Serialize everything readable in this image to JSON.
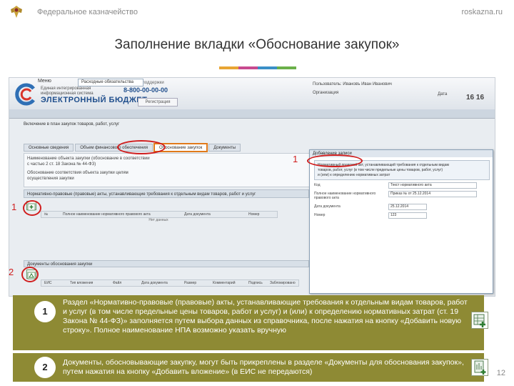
{
  "header": {
    "org_name": "Федеральное казначейство",
    "site": "roskazna.ru",
    "title": "Заполнение вкладки «Обоснование закупок»",
    "accent_colors": [
      "#e8a534",
      "#c84a8f",
      "#3a8fc7",
      "#6bb04a"
    ]
  },
  "app": {
    "logo_small_text": "Единая интегрированная информационная система",
    "logo_name": "ЭЛЕКТРОННЫЙ БЮДЖЕТ",
    "phone_label": "Телефон поддержки",
    "phone": "8-800-00-00-00",
    "support_button": "Регистрация",
    "user_line1": "Пользователь: Ивановъ Иван Иванович",
    "user_line2": "Организация",
    "date_label": "Дата",
    "time": "16 16",
    "nav_menu": "Меню",
    "nav_tab": "Расходные обязательства"
  },
  "document": {
    "title": "Включение в план закупок товаров, работ, услуг",
    "tabs": [
      "Основные сведения",
      "Объем финансового обеспечения",
      "Обоснование закупок",
      "Документы"
    ],
    "active_tab": 2,
    "left_lines": [
      "Наименование объекта закупки (обоснование в соответствии",
      "с частью 2 ст. 18 Закона № 44-ФЗ)",
      "Обоснование соответствия объекта закупки целям",
      "осуществления закупки"
    ],
    "npa_header": "Нормативно-правовые (правовые) акты, устанавливающие требования к отдельным видам товаров, работ и услуг",
    "npa_columns": [
      "№",
      "Полное наименование нормативного правового акта",
      "Дата документа",
      "Номер"
    ],
    "npa_empty": "Нет данных",
    "docs_header": "Документы обоснования закупки",
    "docs_columns": [
      "ЕИС",
      "Тип вложения",
      "Файл",
      "Дата документа",
      "Размер",
      "Комментарий",
      "Подпись",
      "Заблокировано"
    ]
  },
  "dialog": {
    "title": "Добавление записи",
    "rows": [
      "Нормативный правовой акт, устанавливающий требования к отдельным видам",
      "товаров, работ, услуг (в том числе предельные цены товаров, работ, услуг)",
      "и (или) к определению нормативных затрат"
    ],
    "field1_label": "Код",
    "field1_value": "Текст нормативного акта",
    "field2_label": "Полное наименование нормативного правового акта",
    "field2_value": "Приказ № от 25.12.2014",
    "field3_label": "Дата документа",
    "field3_value": "25.12.2014",
    "field4_label": "Номер",
    "field4_value": "123"
  },
  "callouts": {
    "n1": "1",
    "n2": "2"
  },
  "blocks": [
    {
      "number": "1",
      "text": "Раздел «Нормативно-правовые (правовые) акты, устанавливающие требования к отдельным видам товаров, работ и услуг (в том числе предельные цены товаров, работ и услуг) и (или) к определению нормативных затрат (ст. 19 Закона № 44-ФЗ)» заполняется путем выбора данных из справочника, после нажатия на кнопку «Добавить новую строку». Полное наименование НПА возможно указать вручную"
    },
    {
      "number": "2",
      "text": "Документы, обосновывающие закупку, могут быть прикреплены в разделе «Документы для обоснования закупок», путем нажатия на кнопку «Добавить вложение» (в ЕИС не передаются)"
    }
  ],
  "page_number": "12",
  "icons": {
    "emblem": "emblem-icon",
    "add_row": "add-row-icon",
    "add_attachment": "add-attachment-icon"
  }
}
